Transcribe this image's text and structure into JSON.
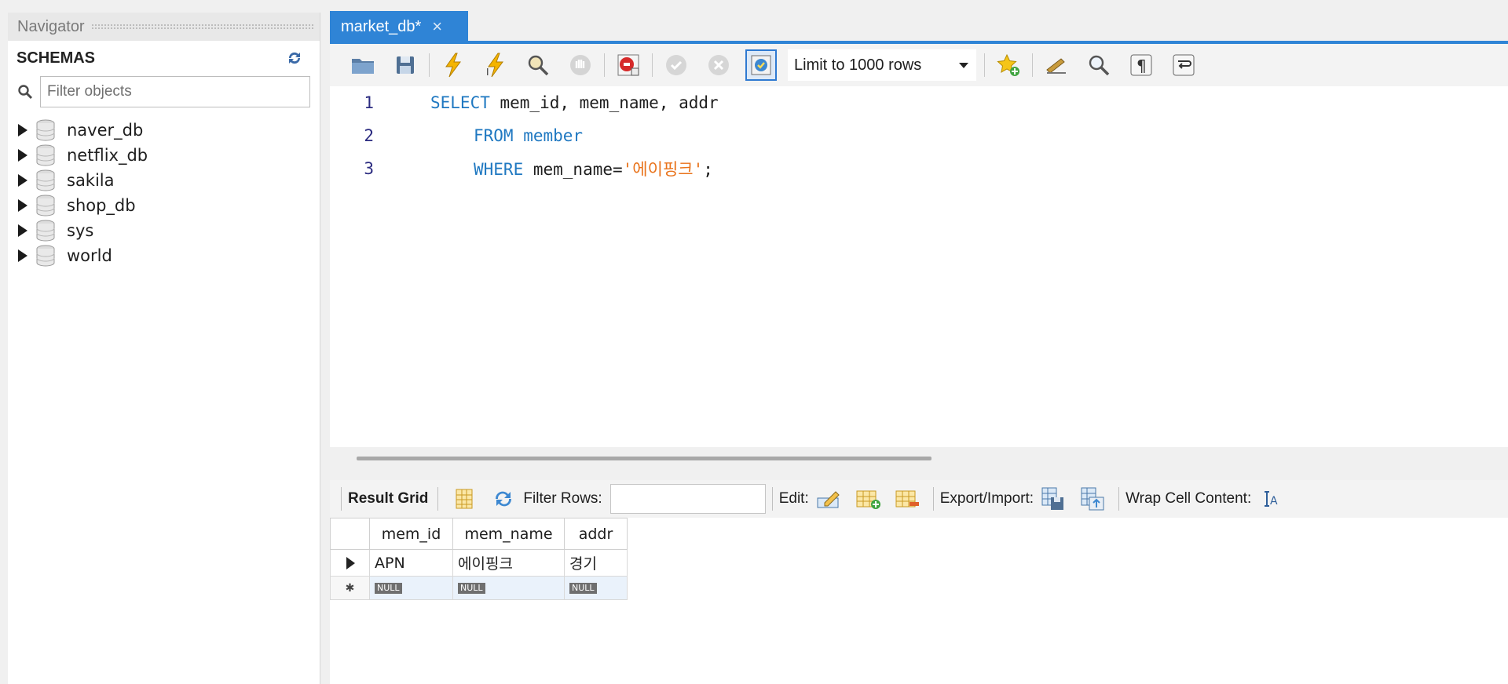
{
  "navigator": {
    "title": "Navigator",
    "schemas_label": "SCHEMAS",
    "filter_placeholder": "Filter objects",
    "schemas": [
      {
        "name": "naver_db"
      },
      {
        "name": "netflix_db"
      },
      {
        "name": "sakila"
      },
      {
        "name": "shop_db"
      },
      {
        "name": "sys"
      },
      {
        "name": "world"
      }
    ]
  },
  "tab": {
    "label": "market_db*",
    "close": "×"
  },
  "toolbar": {
    "limit_value": "Limit to 1000 rows"
  },
  "editor": {
    "lines": [
      {
        "num": "1",
        "kw": "SELECT",
        "rest": " mem_id, mem_name, addr",
        "str": "",
        "end": ""
      },
      {
        "num": "2",
        "kw": "FROM",
        "rest": " member",
        "str": "",
        "end": ""
      },
      {
        "num": "3",
        "kw": "WHERE",
        "rest": " mem_name=",
        "str": "'에이핑크'",
        "end": ";"
      }
    ]
  },
  "results": {
    "result_grid_label": "Result Grid",
    "filter_rows_label": "Filter Rows:",
    "edit_label": "Edit:",
    "export_label": "Export/Import:",
    "wrap_label": "Wrap Cell Content:",
    "columns": [
      "mem_id",
      "mem_name",
      "addr"
    ],
    "rows": [
      [
        "APN",
        "에이핑크",
        "경기"
      ]
    ],
    "null_text": "NULL",
    "new_row_marker": "✱"
  },
  "colors": {
    "accent": "#2f84d6",
    "keyword": "#1f78c1",
    "string": "#e9731b"
  }
}
